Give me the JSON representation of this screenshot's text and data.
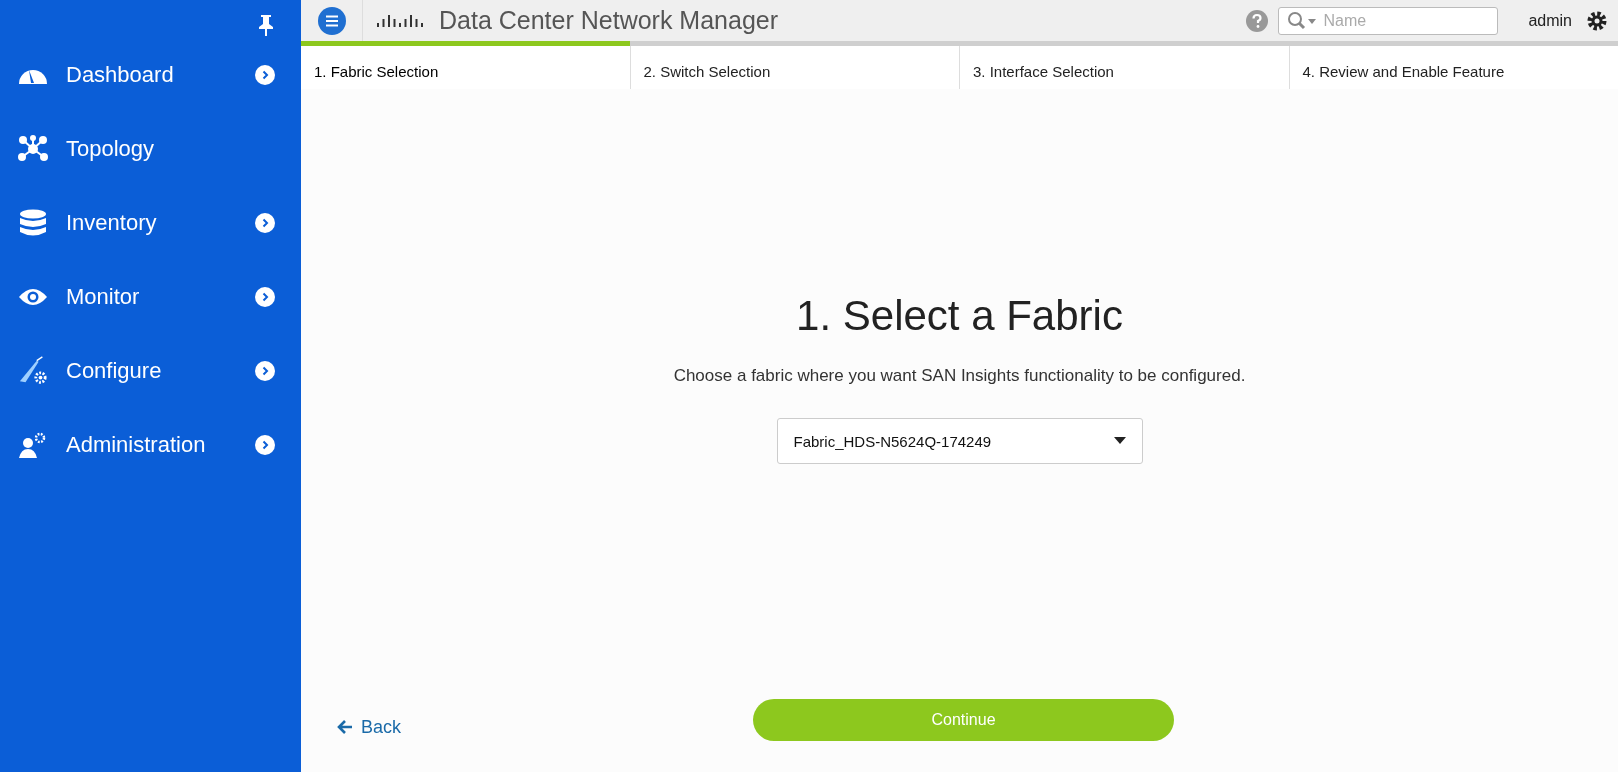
{
  "sidebar": {
    "items": [
      {
        "kind": "dashboard",
        "label": "Dashboard",
        "has_submenu": true
      },
      {
        "kind": "topology",
        "label": "Topology",
        "has_submenu": false
      },
      {
        "kind": "inventory",
        "label": "Inventory",
        "has_submenu": true
      },
      {
        "kind": "monitor",
        "label": "Monitor",
        "has_submenu": true
      },
      {
        "kind": "configure",
        "label": "Configure",
        "has_submenu": true
      },
      {
        "kind": "administration",
        "label": "Administration",
        "has_submenu": true
      }
    ]
  },
  "header": {
    "title": "Data Center Network Manager",
    "search": {
      "placeholder": "Name"
    },
    "user": "admin"
  },
  "steps": [
    {
      "label": "1. Fabric Selection",
      "selected": true
    },
    {
      "label": "2. Switch Selection",
      "selected": false
    },
    {
      "label": "3. Interface Selection",
      "selected": false
    },
    {
      "label": "4. Review and Enable Feature",
      "selected": false
    }
  ],
  "content": {
    "heading": "1. Select a Fabric",
    "description": "Choose a fabric where you want SAN Insights functionality to be configured.",
    "fabric_select": {
      "value": "Fabric_HDS-N5624Q-174249"
    }
  },
  "footer": {
    "back": "Back",
    "continue": "Continue"
  }
}
